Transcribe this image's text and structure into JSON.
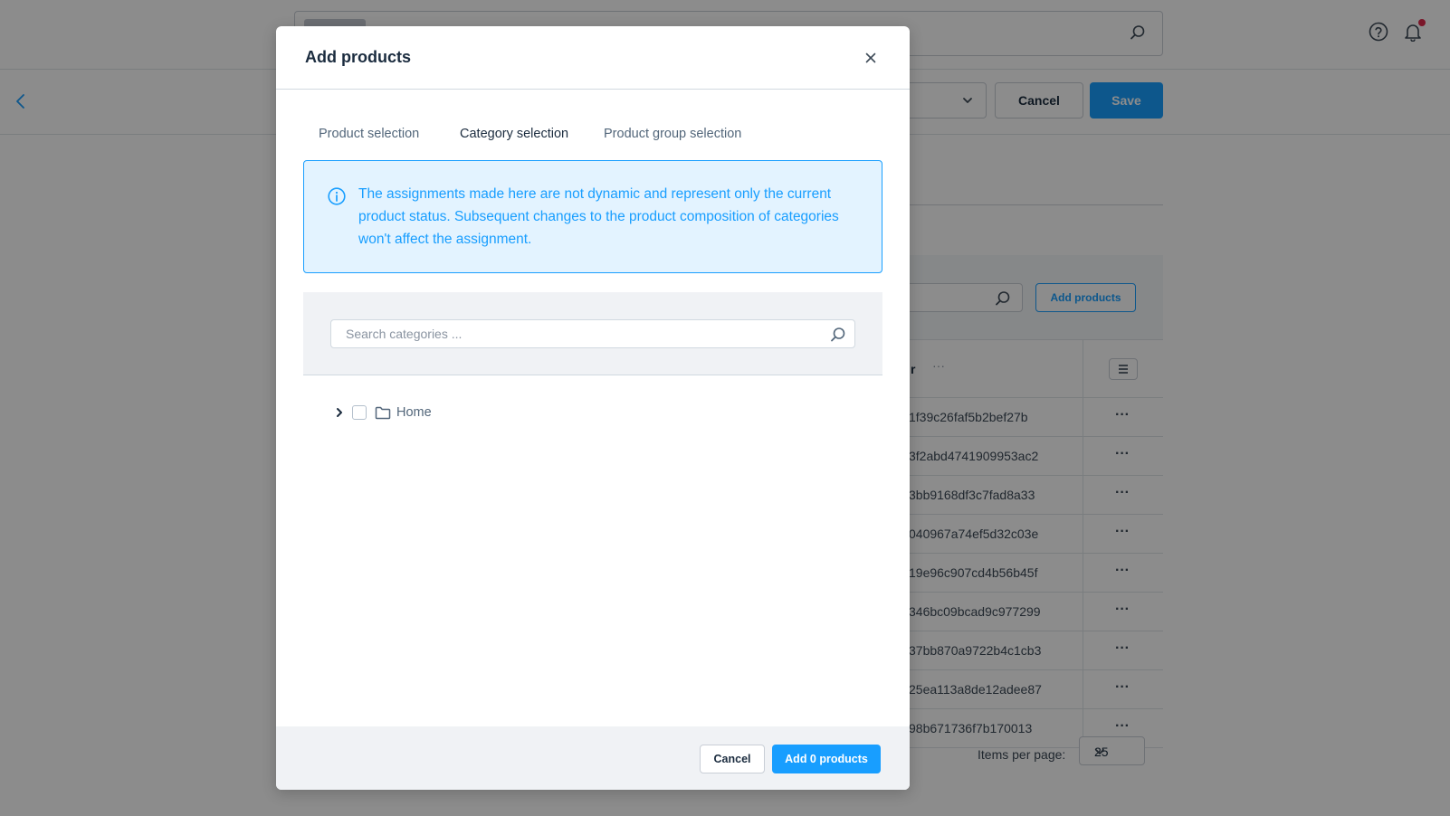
{
  "background": {
    "header": {
      "search_icon": "search-icon",
      "help_icon": "help-circle-icon",
      "bell_icon": "bell-icon"
    },
    "toolbar": {
      "back_icon": "chevron-left-icon",
      "cancel_label": "Cancel",
      "save_label": "Save"
    },
    "card": {
      "add_products_label": "Add products",
      "column_header_fragment": "r",
      "column_header_dots": "···",
      "rows": [
        "1f39c26faf5b2bef27b",
        "3f2abd4741909953ac2",
        "3bb9168df3c7fad8a33",
        "040967a74ef5d32c03e",
        "19e96c907cd4b56b45f",
        "346bc09bcad9c977299",
        "37bb870a9722b4c1cb3",
        "25ea113a8de12adee87",
        "98b671736f7b170013"
      ],
      "row_action": "···",
      "items_per_page_label": "Items per page:",
      "items_per_page_value": "25"
    }
  },
  "modal": {
    "title": "Add products",
    "close_icon": "close-icon",
    "tabs": [
      {
        "label": "Product selection",
        "active": false
      },
      {
        "label": "Category selection",
        "active": true
      },
      {
        "label": "Product group selection",
        "active": false
      }
    ],
    "info": {
      "icon": "info-icon",
      "text": "The assignments made here are not dynamic and represent only the current product status. Subsequent changes to the product composition of categories won't affect the assignment."
    },
    "search": {
      "placeholder": "Search categories ...",
      "icon": "search-icon"
    },
    "tree": [
      {
        "label": "Home",
        "expanded": false,
        "checked": false,
        "icon": "folder-icon"
      }
    ],
    "footer": {
      "cancel_label": "Cancel",
      "add_label": "Add 0 products"
    }
  },
  "colors": {
    "accent": "#189eff",
    "info_bg": "#e3f3ff",
    "text": "#1b2c3f",
    "muted": "#52667a",
    "panel_bg": "#f0f2f5",
    "notification": "#de294c"
  }
}
